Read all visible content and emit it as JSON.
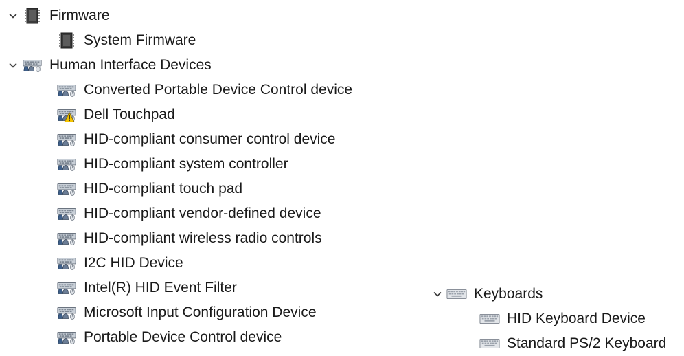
{
  "tree": {
    "firmware": {
      "label": "Firmware",
      "icon": "chip-icon",
      "expanded": true,
      "children": [
        {
          "label": "System Firmware",
          "icon": "chip-icon"
        }
      ]
    },
    "hid": {
      "label": "Human Interface Devices",
      "icon": "hid-icon",
      "expanded": true,
      "children": [
        {
          "label": "Converted Portable Device Control device",
          "icon": "hid-icon"
        },
        {
          "label": "Dell Touchpad",
          "icon": "hid-warning-icon"
        },
        {
          "label": "HID-compliant consumer control device",
          "icon": "hid-icon"
        },
        {
          "label": "HID-compliant system controller",
          "icon": "hid-icon"
        },
        {
          "label": "HID-compliant touch pad",
          "icon": "hid-icon"
        },
        {
          "label": "HID-compliant vendor-defined device",
          "icon": "hid-icon"
        },
        {
          "label": "HID-compliant wireless radio controls",
          "icon": "hid-icon"
        },
        {
          "label": "I2C HID Device",
          "icon": "hid-icon"
        },
        {
          "label": "Intel(R) HID Event Filter",
          "icon": "hid-icon"
        },
        {
          "label": "Microsoft Input Configuration Device",
          "icon": "hid-icon"
        },
        {
          "label": "Portable Device Control device",
          "icon": "hid-icon"
        }
      ]
    },
    "keyboards": {
      "label": "Keyboards",
      "icon": "keyboard-icon",
      "expanded": true,
      "children": [
        {
          "label": "HID Keyboard Device",
          "icon": "keyboard-icon"
        },
        {
          "label": "Standard PS/2 Keyboard",
          "icon": "keyboard-icon"
        }
      ]
    }
  }
}
